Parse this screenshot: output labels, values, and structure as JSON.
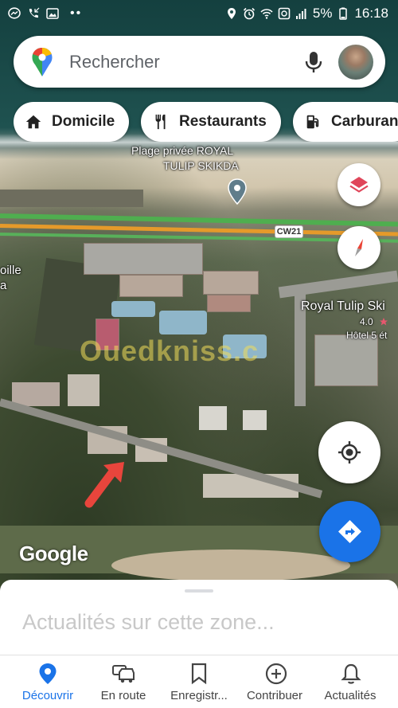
{
  "status_bar": {
    "battery": "5%",
    "time": "16:18"
  },
  "search": {
    "placeholder": "Rechercher"
  },
  "chips": [
    {
      "label": "Domicile",
      "icon": "home-icon"
    },
    {
      "label": "Restaurants",
      "icon": "restaurant-icon"
    },
    {
      "label": "Carburan",
      "icon": "gas-station-icon"
    }
  ],
  "map": {
    "place_label_1": "Plage privée ROYAL",
    "place_label_2": "TULIP SKIKDA",
    "road_label": "CW21",
    "hotel_name": "Royal Tulip Ski",
    "hotel_rating": "4.0",
    "hotel_category": "Hôtel 5 ét",
    "left_label_1": "oille",
    "left_label_2": "a",
    "watermark": "Ouedkniss.c",
    "logo": "Google"
  },
  "sheet": {
    "title": "Actualités sur cette zone..."
  },
  "nav": [
    {
      "label": "Découvrir",
      "icon": "explore-pin-icon",
      "active": true
    },
    {
      "label": "En route",
      "icon": "car-icon"
    },
    {
      "label": "Enregistr...",
      "icon": "bookmark-icon"
    },
    {
      "label": "Contribuer",
      "icon": "add-circle-icon"
    },
    {
      "label": "Actualités",
      "icon": "bell-icon"
    }
  ],
  "colors": {
    "accent": "#1a73e8",
    "road_green": "#4fae4f",
    "road_orange": "#e59a2a"
  }
}
